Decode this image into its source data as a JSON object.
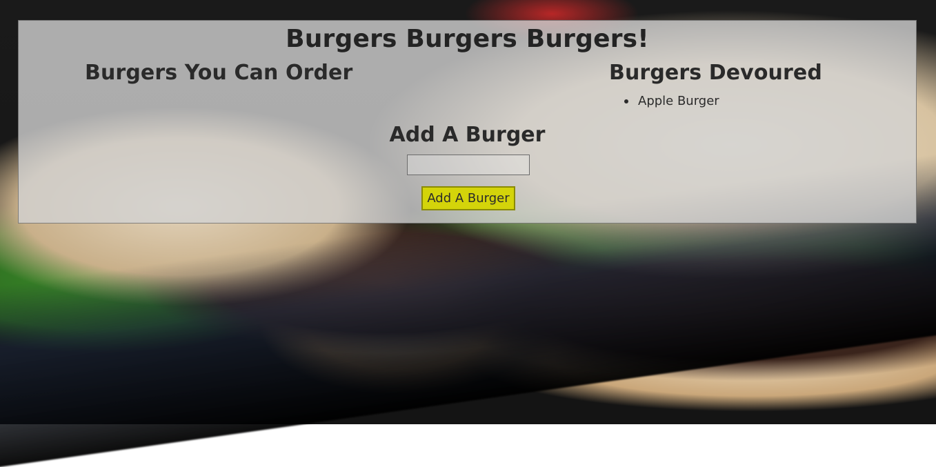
{
  "page": {
    "title": "Burgers Burgers Burgers!"
  },
  "order": {
    "heading": "Burgers You Can Order",
    "items": []
  },
  "devoured": {
    "heading": "Burgers Devoured",
    "items": [
      {
        "name": "Apple Burger"
      }
    ]
  },
  "add_form": {
    "heading": "Add A Burger",
    "input_value": "",
    "input_placeholder": "",
    "button_label": "Add A Burger"
  },
  "colors": {
    "button_background": "#d4d40a",
    "panel_background": "rgba(210,210,210,0.80)"
  }
}
